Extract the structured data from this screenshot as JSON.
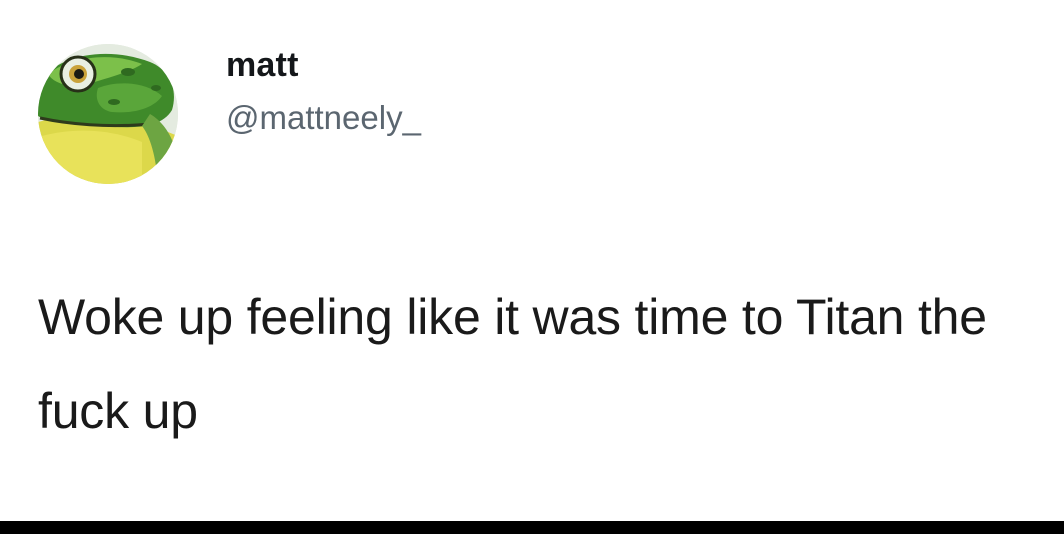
{
  "tweet": {
    "author": {
      "display_name": "matt",
      "handle": "@mattneely_",
      "avatar_icon": "frog-avatar"
    },
    "text": "Woke up feeling like it was time to Titan the fuck up"
  },
  "colors": {
    "background": "#ffffff",
    "name": "#14171a",
    "handle": "#5b6670",
    "body_text": "#1a1a1a",
    "bottom_bar": "#000000"
  }
}
